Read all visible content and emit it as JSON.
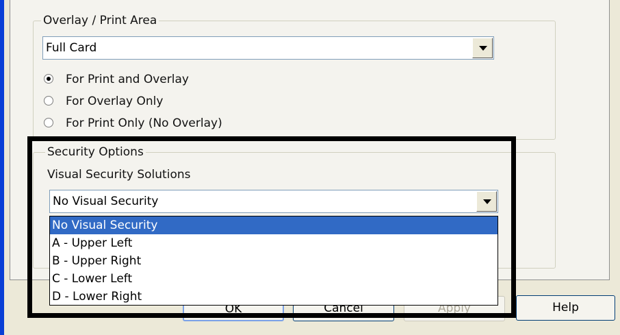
{
  "overlay_group": {
    "title": "Overlay / Print Area",
    "combo_value": "Full Card",
    "radios": [
      {
        "label": "For Print and Overlay",
        "checked": true
      },
      {
        "label": "For Overlay Only",
        "checked": false
      },
      {
        "label": "For Print Only (No Overlay)",
        "checked": false
      }
    ]
  },
  "security_group": {
    "title": "Security Options",
    "subtitle": "Visual Security Solutions",
    "combo_value": "No Visual Security",
    "options": [
      {
        "label": "No Visual Security",
        "selected": true
      },
      {
        "label": "A - Upper Left",
        "selected": false
      },
      {
        "label": "B - Upper Right",
        "selected": false
      },
      {
        "label": "C - Lower Left",
        "selected": false
      },
      {
        "label": "D - Lower Right",
        "selected": false
      }
    ]
  },
  "buttons": {
    "ok": "OK",
    "cancel": "Cancel",
    "apply": "Apply",
    "help": "Help"
  },
  "colors": {
    "selection": "#316ac5",
    "highlight_border": "#000000",
    "window_frame": "#0a3fd6"
  }
}
